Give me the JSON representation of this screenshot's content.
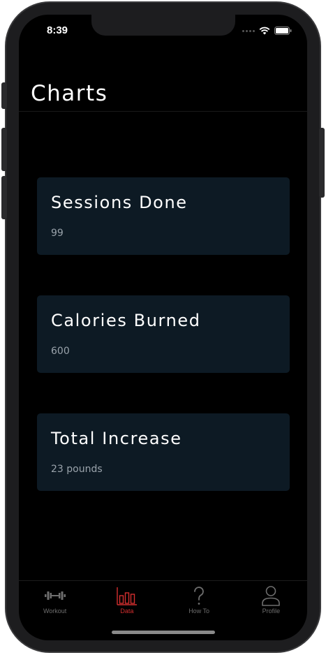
{
  "status": {
    "time": "8:39"
  },
  "page": {
    "title": "Charts"
  },
  "cards": [
    {
      "title": "Sessions Done",
      "value": "99"
    },
    {
      "title": "Calories Burned",
      "value": "600"
    },
    {
      "title": "Total Increase",
      "value": "23 pounds"
    }
  ],
  "tabs": [
    {
      "label": "Workout",
      "icon": "dumbbell-icon",
      "active": false
    },
    {
      "label": "Data",
      "icon": "bar-chart-icon",
      "active": true
    },
    {
      "label": "How To",
      "icon": "question-icon",
      "active": false
    },
    {
      "label": "Profile",
      "icon": "person-icon",
      "active": false
    }
  ],
  "colors": {
    "accent": "#d32f2f",
    "card_bg": "#0d1a24",
    "background": "#000000"
  }
}
